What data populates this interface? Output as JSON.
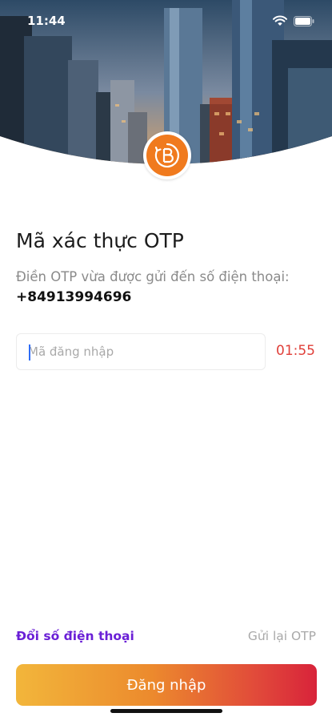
{
  "status_bar": {
    "time": "11:44"
  },
  "screen": {
    "title": "Mã xác thực OTP",
    "subtitle": "Điền OTP vừa được gửi đến số điện thoại:",
    "phone_number": "+84913994696"
  },
  "otp": {
    "placeholder": "Mã đăng nhập",
    "value": "",
    "countdown": "01:55"
  },
  "actions": {
    "change_phone": "Đổi số điện thoại",
    "resend_otp": "Gửi lại OTP",
    "login_button": "Đăng nhập"
  },
  "colors": {
    "accent_purple": "#6a1fd6",
    "timer_red": "#e0403a",
    "logo_orange": "#f07a1e",
    "button_gradient_start": "#f2b63b",
    "button_gradient_end": "#d8233a"
  },
  "icons": [
    "wifi-icon",
    "battery-icon",
    "brand-logo-icon"
  ]
}
